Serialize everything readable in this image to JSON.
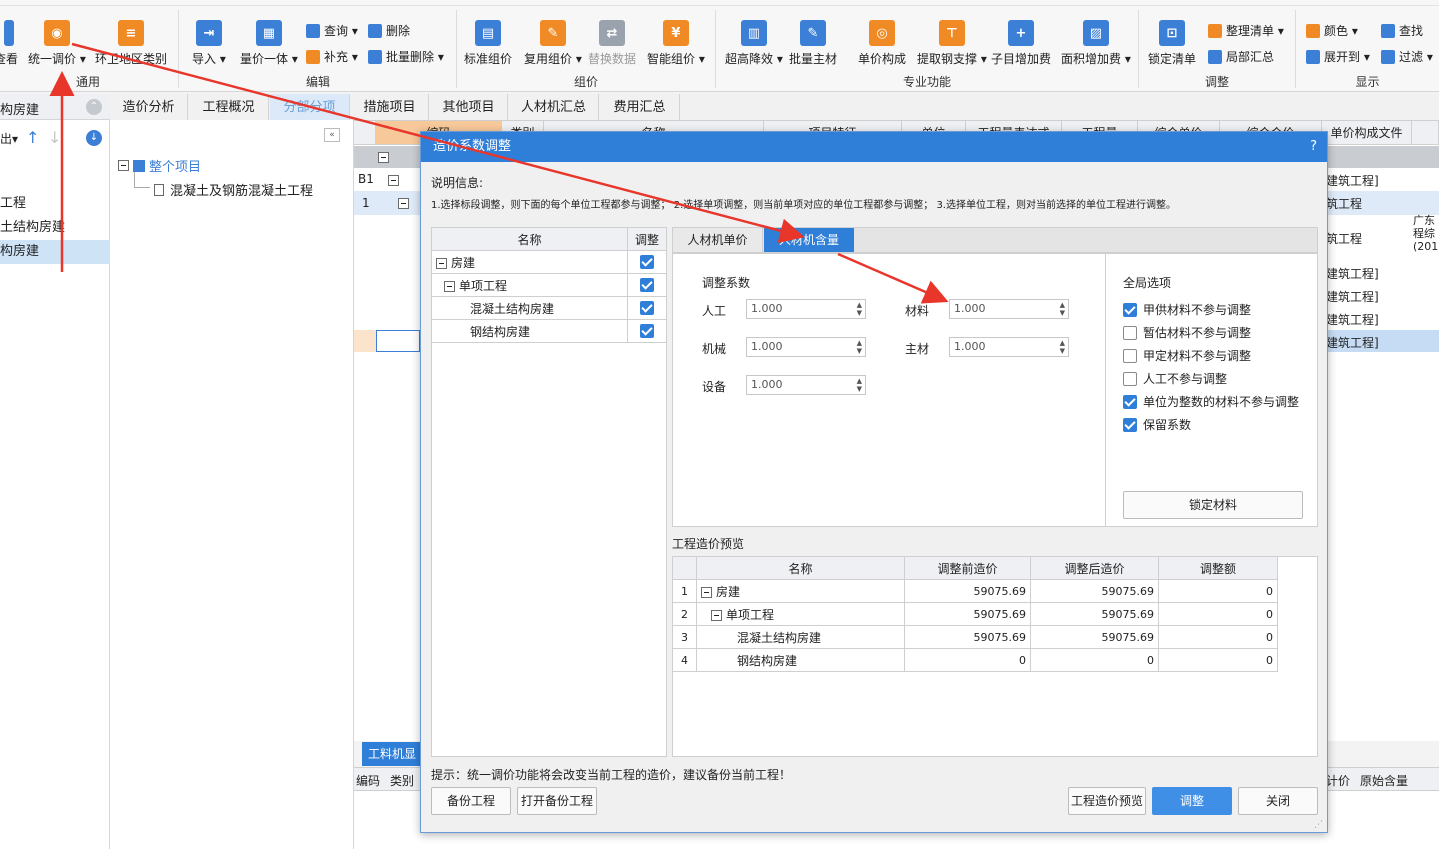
{
  "ribbon": {
    "groups": {
      "general": "通用",
      "edit": "编辑",
      "pricing": "组价",
      "professional": "专业功能",
      "adjust": "调整",
      "display": "显示"
    },
    "buttons": {
      "view": "查看",
      "unified_adjust": "统一调价",
      "env_area": "环卫地区类别",
      "import": "导入",
      "qty_price": "量价一体",
      "query": "查询",
      "supplement": "补充",
      "delete": "删除",
      "batch_delete": "批量删除",
      "std_pricing": "标准组价",
      "reuse_pricing": "复用组价",
      "replace_data": "替换数据",
      "smart_pricing": "智能组价",
      "super_high": "超高降效",
      "batch_main": "批量主材",
      "unit_price": "单价构成",
      "steel": "提取钢支撑",
      "sub_add": "子目增加费",
      "area_add": "面积增加费",
      "lock_list": "锁定清单",
      "organize": "整理清单",
      "partial_sum": "局部汇总",
      "color": "颜色",
      "expand": "展开到",
      "find": "查找",
      "filter": "过滤"
    }
  },
  "leftpane": {
    "header": "构房建",
    "export": "出",
    "items": [
      "工程",
      "土结构房建",
      "构房建"
    ]
  },
  "tabs": [
    "造价分析",
    "工程概况",
    "分部分项",
    "措施项目",
    "其他项目",
    "人材机汇总",
    "费用汇总"
  ],
  "tree": {
    "root": "整个项目",
    "child": "混凝土及钢筋混凝土工程"
  },
  "grid": {
    "headers": [
      "编码",
      "类别",
      "名称",
      "项目特征",
      "单位",
      "工程量表达式",
      "工程量",
      "综合单价",
      "综合合价",
      "单价构成文件"
    ],
    "rowlabels": [
      "B1",
      "1"
    ],
    "right_cells": [
      "建筑工程]",
      "筑工程",
      "筑工程",
      "建筑工程]",
      "建筑工程]",
      "建筑工程]",
      "建筑工程]"
    ],
    "far_right": "广东\n程综\n(201",
    "bottom_tab": "工料机显",
    "bottom_headers": [
      "编码",
      "类别"
    ],
    "bottom_right_headers": [
      "计价",
      "原始含量"
    ]
  },
  "dialog": {
    "title": "造价系数调整",
    "help": "?",
    "info_title": "说明信息:",
    "info_text": "1.选择标段调整，则下面的每个单位工程都参与调整；  2.选择单项调整，则当前单项对应的单位工程都参与调整；  3.选择单位工程，则对当前选择的单位工程进行调整。",
    "left_table": {
      "headers": [
        "名称",
        "调整"
      ],
      "rows": [
        {
          "name": "房建",
          "checked": true
        },
        {
          "name": "单项工程",
          "checked": true
        },
        {
          "name": "混凝土结构房建",
          "checked": true
        },
        {
          "name": "钢结构房建",
          "checked": true
        }
      ]
    },
    "tabs": [
      "人材机单价",
      "人材机含量"
    ],
    "coef_title": "调整系数",
    "coefs": {
      "labor": "人工",
      "labor_val": "1.000",
      "material": "材料",
      "material_val": "1.000",
      "machine": "机械",
      "machine_val": "1.000",
      "main_material": "主材",
      "main_material_val": "1.000",
      "equipment": "设备",
      "equipment_val": "1.000"
    },
    "global_title": "全局选项",
    "options": [
      {
        "label": "甲供材料不参与调整",
        "checked": true
      },
      {
        "label": "暂估材料不参与调整",
        "checked": false
      },
      {
        "label": "甲定材料不参与调整",
        "checked": false
      },
      {
        "label": "人工不参与调整",
        "checked": false
      },
      {
        "label": "单位为整数的材料不参与调整",
        "checked": true
      },
      {
        "label": "保留系数",
        "checked": true
      }
    ],
    "lock_material": "锁定材料",
    "preview_title": "工程造价预览",
    "preview": {
      "headers": [
        "名称",
        "调整前造价",
        "调整后造价",
        "调整额"
      ],
      "rows": [
        {
          "no": "1",
          "name": "房建",
          "before": "59075.69",
          "after": "59075.69",
          "diff": "0"
        },
        {
          "no": "2",
          "name": "单项工程",
          "before": "59075.69",
          "after": "59075.69",
          "diff": "0"
        },
        {
          "no": "3",
          "name": "混凝土结构房建",
          "before": "59075.69",
          "after": "59075.69",
          "diff": "0"
        },
        {
          "no": "4",
          "name": "钢结构房建",
          "before": "0",
          "after": "0",
          "diff": "0"
        }
      ]
    },
    "tip": "提示：统一调价功能将会改变当前工程的造价，建议备份当前工程！",
    "buttons": {
      "backup": "备份工程",
      "open_backup": "打开备份工程",
      "preview": "工程造价预览",
      "adjust": "调整",
      "close": "关闭"
    }
  },
  "colors": {
    "accent": "#2f7fd9",
    "arrow": "#e8362b"
  }
}
